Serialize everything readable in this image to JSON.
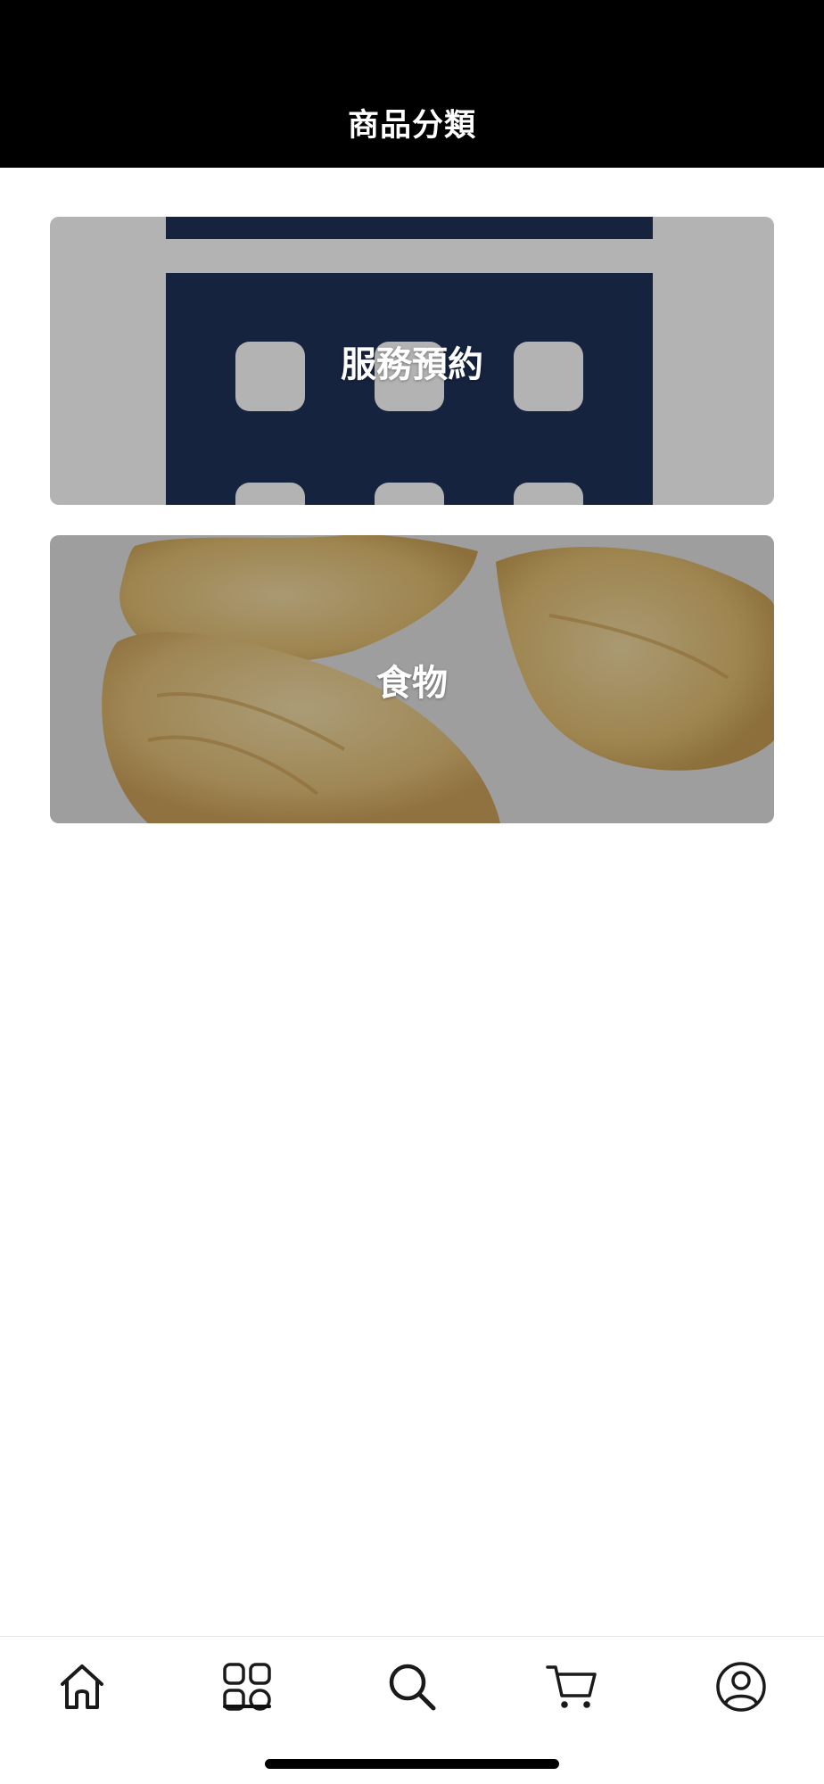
{
  "header": {
    "title": "商品分類"
  },
  "categories": [
    {
      "label": "服務預約",
      "image": "calendar-illustration"
    },
    {
      "label": "食物",
      "image": "dried-fish-maw-photo"
    }
  ],
  "tabbar": {
    "items": [
      {
        "icon": "home-icon"
      },
      {
        "icon": "categories-grid-icon",
        "active": true
      },
      {
        "icon": "search-icon"
      },
      {
        "icon": "cart-icon"
      },
      {
        "icon": "profile-icon"
      }
    ]
  },
  "colors": {
    "header_bg": "#000000",
    "calendar_navy": "#16233f",
    "card_gray": "#b3b3b3",
    "icon_stroke": "#1a1a1a"
  }
}
